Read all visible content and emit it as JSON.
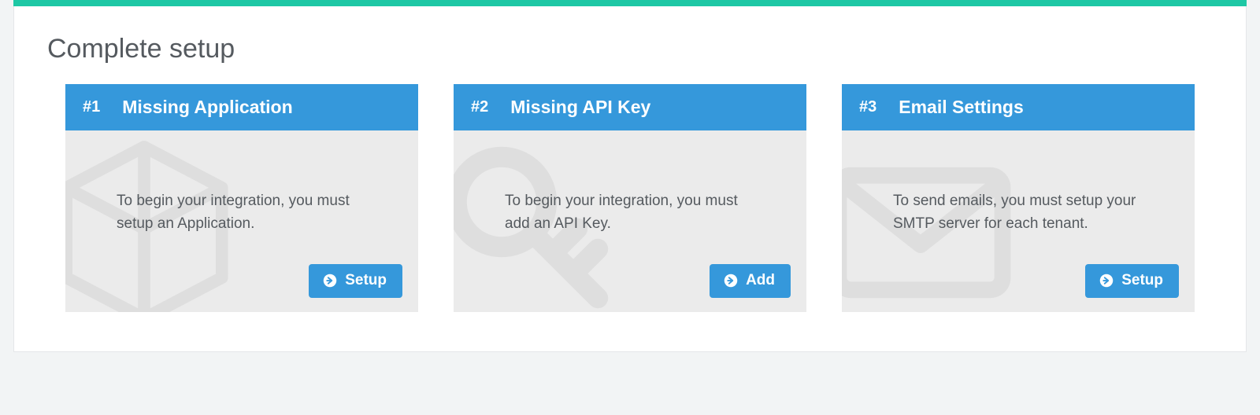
{
  "page": {
    "title": "Complete setup"
  },
  "cards": [
    {
      "number": "#1",
      "title": "Missing Application",
      "description": "To begin your integration, you must setup an Application.",
      "action": "Setup"
    },
    {
      "number": "#2",
      "title": "Missing API Key",
      "description": "To begin your integration, you must add an API Key.",
      "action": "Add"
    },
    {
      "number": "#3",
      "title": "Email Settings",
      "description": "To send emails, you must setup your SMTP server for each tenant.",
      "action": "Setup"
    }
  ],
  "accent_color": "#1ec8a5",
  "primary_color": "#3598db"
}
